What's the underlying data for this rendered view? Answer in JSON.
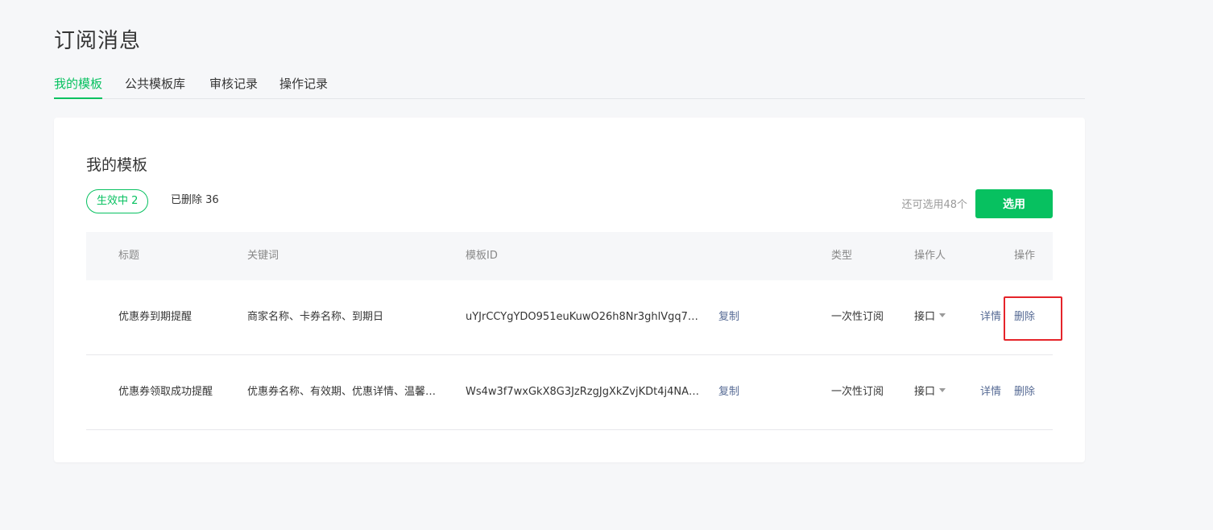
{
  "page": {
    "title": "订阅消息"
  },
  "tabs": [
    {
      "label": "我的模板",
      "active": true
    },
    {
      "label": "公共模板库",
      "active": false
    },
    {
      "label": "审核记录",
      "active": false
    },
    {
      "label": "操作记录",
      "active": false
    }
  ],
  "card": {
    "title": "我的模板",
    "filters": {
      "active_label": "生效中 2",
      "deleted_label": "已删除  36"
    },
    "quota_text": "还可选用48个",
    "select_button": "选用"
  },
  "table": {
    "headers": {
      "title": "标题",
      "keywords": "关键词",
      "template_id": "模板ID",
      "type": "类型",
      "operator": "操作人",
      "actions": "操作"
    },
    "rows": [
      {
        "title": "优惠券到期提醒",
        "keywords": "商家名称、卡券名称、到期日",
        "template_id": "uYJrCCYgYDO951euKuwO26h8Nr3ghlVgq7…",
        "copy": "复制",
        "type": "一次性订阅",
        "operator": "接口",
        "detail": "详情",
        "delete": "删除"
      },
      {
        "title": "优惠券领取成功提醒",
        "keywords": "优惠券名称、有效期、优惠详情、温馨…",
        "template_id": "Ws4w3f7wxGkX8G3JzRzgJgXkZvjKDt4j4NA…",
        "copy": "复制",
        "type": "一次性订阅",
        "operator": "接口",
        "detail": "详情",
        "delete": "删除"
      }
    ]
  },
  "colors": {
    "accent": "#07c160",
    "link": "#576b95",
    "highlight": "#e5242a",
    "background": "#f6f7f9"
  }
}
